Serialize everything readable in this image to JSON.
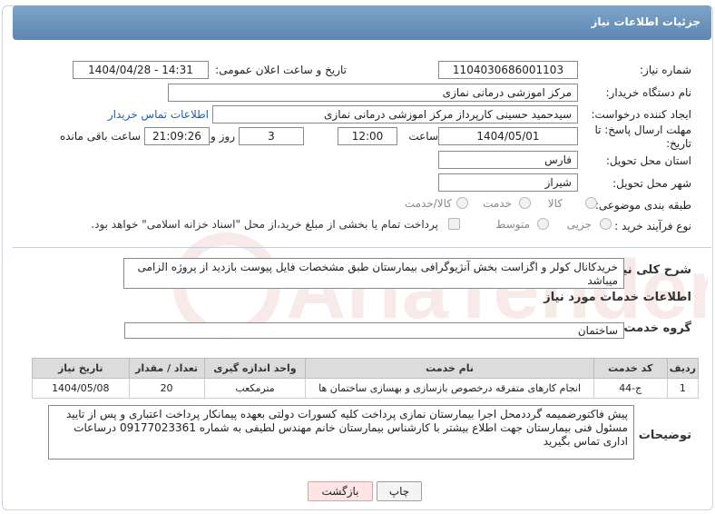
{
  "header": {
    "title": "جزئیات اطلاعات نیاز"
  },
  "form": {
    "need_number_label": "شماره نیاز:",
    "need_number": "1104030686001103",
    "announce_label": "تاریخ و ساعت اعلان عمومی:",
    "announce_value": "1404/04/28 - 14:31",
    "buyer_org_label": "نام دستگاه خریدار:",
    "buyer_org": "مرکز اموزشی درمانی نمازی",
    "creator_label": "ایجاد کننده درخواست:",
    "creator": "سیدحمید حسینی کارپرداز مرکز اموزشی درمانی نمازی",
    "contact_link": "اطلاعات تماس خریدار",
    "deadline_label": "مهلت ارسال پاسخ: تا تاریخ:",
    "deadline_date": "1404/05/01",
    "time_label": "ساعت",
    "deadline_time": "12:00",
    "days_value": "3",
    "days_label": "روز و",
    "remaining_time": "21:09:26",
    "remaining_label": "ساعت باقی مانده",
    "province_label": "استان محل تحویل:",
    "province": "فارس",
    "city_label": "شهر محل تحویل:",
    "city": "شیراز",
    "category_label": "طبقه بندی موضوعی:",
    "category_options": [
      "کالا",
      "خدمت",
      "کالا/خدمت"
    ],
    "process_label": "نوع فرآیند خرید :",
    "process_options": [
      "جزیی",
      "متوسط"
    ],
    "payment_note": "پرداخت تمام یا بخشی از مبلغ خرید،از محل \"اسناد خزانه اسلامی\" خواهد بود."
  },
  "description": {
    "label": "شرح کلی نیاز:",
    "text": "خریدکانال کولر و اگزاست بخش آنژیوگرافی بیمارستان طبق مشخصات فایل پیوست بازدید از پروژه الزامی میباشد"
  },
  "services": {
    "section_title": "اطلاعات خدمات مورد نیاز",
    "group_label": "گروه خدمت:",
    "group_value": "ساختمان",
    "table": {
      "headers": [
        "ردیف",
        "کد خدمت",
        "نام خدمت",
        "واحد اندازه گیری",
        "تعداد / مقدار",
        "تاریخ نیاز"
      ],
      "rows": [
        [
          "1",
          "ج-44",
          "انجام کارهای متفرقه درخصوص بازسازی و بهسازی ساختمان ها",
          "مترمکعب",
          "20",
          "1404/05/08"
        ]
      ]
    }
  },
  "buyer_notes": {
    "label": "توضیحات خریدار:",
    "text": "پیش فاکتورضمیمه گرددمحل اجرا  بیمارستان نمازی پرداخت کلیه کسورات دولتی بعهده پیمانکار پرداخت اعتباری و پس از تایید مسئول فنی بیمارستان جهت اطلاع بیشتر با کارشناس بیمارستان خانم مهندس لطیفی به شماره 09177023361 درساعات اداری تماس بگیرید"
  },
  "buttons": {
    "print": "چاپ",
    "back": "بازگشت"
  },
  "colors": {
    "header": "#6b91bb",
    "link": "#1f5fb0",
    "back_button": "#fde5e5"
  },
  "watermark_text": "AriaTender.neT"
}
